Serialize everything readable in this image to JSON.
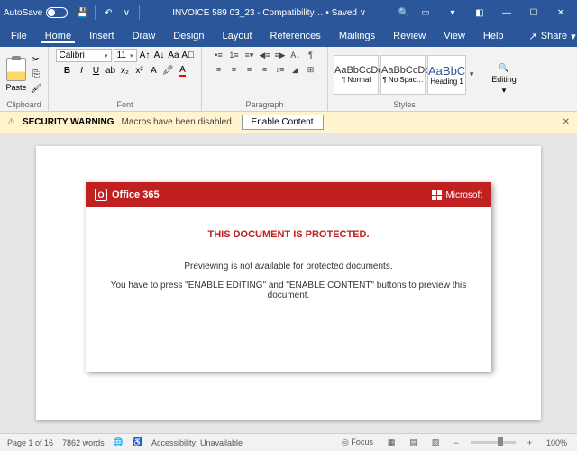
{
  "titlebar": {
    "autosave_label": "AutoSave",
    "autosave_state": "Off",
    "doc_title": "INVOICE 589 03_23 - Compatibility… • Saved ∨"
  },
  "menu": {
    "file": "File",
    "home": "Home",
    "insert": "Insert",
    "draw": "Draw",
    "design": "Design",
    "layout": "Layout",
    "references": "References",
    "mailings": "Mailings",
    "review": "Review",
    "view": "View",
    "help": "Help",
    "share": "Share"
  },
  "ribbon": {
    "clipboard_label": "Clipboard",
    "paste": "Paste",
    "font_label": "Font",
    "font_name": "Calibri",
    "font_size": "11",
    "paragraph_label": "Paragraph",
    "styles_label": "Styles",
    "style_preview": "AaBbCcDd",
    "style_preview_heading": "AaBbC",
    "style_normal": "¶ Normal",
    "style_nospacing": "¶ No Spac…",
    "style_heading1": "Heading 1",
    "editing_label": "Editing"
  },
  "warning": {
    "label": "SECURITY WARNING",
    "message": "Macros have been disabled.",
    "button": "Enable Content"
  },
  "card": {
    "o365": "Office 365",
    "ms": "Microsoft",
    "protected": "THIS DOCUMENT IS PROTECTED.",
    "line1": "Previewing is not available for protected documents.",
    "line2": "You have to press \"ENABLE EDITING\" and \"ENABLE CONTENT\" buttons to preview this document."
  },
  "status": {
    "page": "Page 1 of 16",
    "words": "7862 words",
    "accessibility": "Accessibility: Unavailable",
    "focus": "Focus",
    "zoom": "100%"
  }
}
